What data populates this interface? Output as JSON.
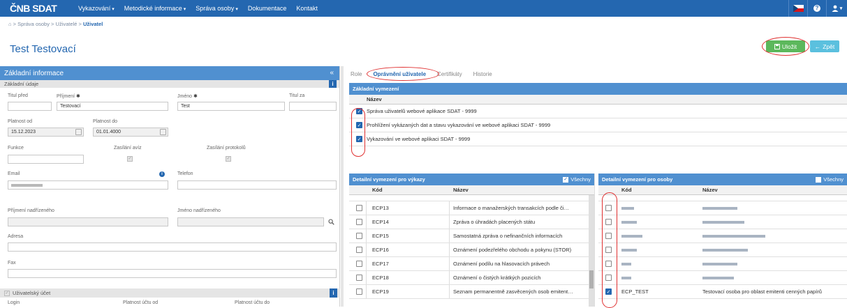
{
  "header": {
    "logo": "ČNB SDAT",
    "nav": [
      {
        "label": "Vykazování",
        "dropdown": true
      },
      {
        "label": "Metodické informace",
        "dropdown": true
      },
      {
        "label": "Správa osoby",
        "dropdown": true
      },
      {
        "label": "Dokumentace",
        "dropdown": false
      },
      {
        "label": "Kontakt",
        "dropdown": false
      }
    ]
  },
  "breadcrumb": {
    "items": [
      "Správa osoby",
      "Uživatelé"
    ],
    "current": "Uživatel"
  },
  "page_title": "Test Testovací",
  "actions": {
    "save": "Uložit",
    "back": "Zpět"
  },
  "left": {
    "title": "Základní informace",
    "basic_section": "Základní údaje",
    "fields": {
      "titul_pred": {
        "label": "Titul před",
        "value": ""
      },
      "prijmeni": {
        "label": "Příjmení",
        "value": "Testovací"
      },
      "jmeno": {
        "label": "Jméno",
        "value": "Test"
      },
      "titul_za": {
        "label": "Titul za",
        "value": ""
      },
      "platnost_od": {
        "label": "Platnost od",
        "value": "15.12.2023"
      },
      "platnost_do": {
        "label": "Platnost do",
        "value": "01.01.4000"
      },
      "funkce": {
        "label": "Funkce",
        "value": ""
      },
      "zasilani_aviz": {
        "label": "Zasílání avíz"
      },
      "zasilani_protokolu": {
        "label": "Zasílání protokolů"
      },
      "email": {
        "label": "Email"
      },
      "telefon": {
        "label": "Telefon",
        "value": ""
      },
      "prijmeni_nadrizeneho": {
        "label": "Příjmení nadřízeného",
        "value": ""
      },
      "jmeno_nadrizeneho": {
        "label": "Jméno nadřízeného",
        "value": ""
      },
      "adresa": {
        "label": "Adresa",
        "value": ""
      },
      "fax": {
        "label": "Fax",
        "value": ""
      }
    },
    "account_section": "Uživatelský účet",
    "account_labels": {
      "login": "Login",
      "od": "Platnost účtu od",
      "do": "Platnost účtu do"
    },
    "required_mark": "✱"
  },
  "tabs": [
    {
      "label": "Role",
      "active": false
    },
    {
      "label": "Oprávnění uživatele",
      "active": true
    },
    {
      "label": "Certifikáty",
      "active": false
    },
    {
      "label": "Historie",
      "active": false
    }
  ],
  "zakladni": {
    "title": "Základní vymezení",
    "col_name": "Název",
    "rows": [
      {
        "checked": true,
        "name": "Správa uživatelů webové aplikace SDAT - 9999"
      },
      {
        "checked": true,
        "name": "Prohlížení vykázaných dat a stavu vykazování ve webové aplikaci SDAT - 9999"
      },
      {
        "checked": true,
        "name": "Vykazování ve webové aplikaci SDAT - 9999"
      }
    ]
  },
  "vykazy": {
    "title": "Detailní vymezení pro výkazy",
    "all_label": "Všechny",
    "col_code": "Kód",
    "col_name": "Název",
    "rows": [
      {
        "checked": false,
        "code": "ECP13",
        "name": "Informace o manažerských transakcích podle či…"
      },
      {
        "checked": false,
        "code": "ECP14",
        "name": "Zpráva o úhradách placených státu"
      },
      {
        "checked": false,
        "code": "ECP15",
        "name": "Samostatná zpráva o nefinančních informacích"
      },
      {
        "checked": false,
        "code": "ECP16",
        "name": "Oznámení podezřelého obchodu a pokynu (STOR)"
      },
      {
        "checked": false,
        "code": "ECP17",
        "name": "Oznámení podílu na hlasovacích právech"
      },
      {
        "checked": false,
        "code": "ECP18",
        "name": "Oznámení o čistých krátkých pozicích"
      },
      {
        "checked": false,
        "code": "ECP19",
        "name": "Seznam permanentně zasvěcených osob emitent…"
      }
    ]
  },
  "osoby": {
    "title": "Detailní vymezení pro osoby",
    "all_label": "Všechny",
    "col_code": "Kód",
    "col_name": "Název",
    "last_row": {
      "checked": true,
      "code": "ECP_TEST",
      "name": "Testovací osoba pro oblast emitenti cenných papírů"
    }
  }
}
